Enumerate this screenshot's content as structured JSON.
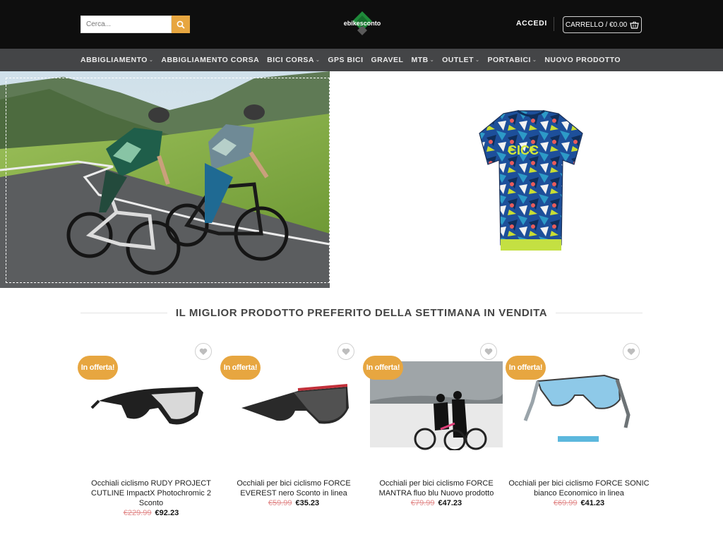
{
  "header": {
    "search_placeholder": "Cerca...",
    "logo_text": "ebikesconto",
    "login_label": "ACCEDI",
    "cart_label": "CARRELLO / €0.00"
  },
  "nav": {
    "items": [
      {
        "label": "ABBIGLIAMENTO",
        "dropdown": true
      },
      {
        "label": "ABBIGLIAMENTO CORSA",
        "dropdown": false
      },
      {
        "label": "BICI CORSA",
        "dropdown": true
      },
      {
        "label": "GPS BICI",
        "dropdown": false
      },
      {
        "label": "GRAVEL",
        "dropdown": false
      },
      {
        "label": "MTB",
        "dropdown": true
      },
      {
        "label": "OUTLET",
        "dropdown": true
      },
      {
        "label": "PORTABICI",
        "dropdown": true
      },
      {
        "label": "NUOVO PRODOTTO",
        "dropdown": false
      }
    ]
  },
  "section": {
    "title": "IL MIGLIOR PRODOTTO PREFERITO DELLA SETTIMANA IN VENDITA"
  },
  "products": [
    {
      "badge": "In offerta!",
      "title": "Occhiali ciclismo RUDY PROJECT CUTLINE ImpactX Photochromic 2 Sconto",
      "old_price": "€229.99",
      "new_price": "€92.23"
    },
    {
      "badge": "In offerta!",
      "title": "Occhiali per bici ciclismo FORCE EVEREST nero Sconto in linea",
      "old_price": "€59.99",
      "new_price": "€35.23"
    },
    {
      "badge": "In offerta!",
      "title": "Occhiali per bici ciclismo FORCE MANTRA fluo blu Nuovo prodotto",
      "old_price": "€79.99",
      "new_price": "€47.23"
    },
    {
      "badge": "In offerta!",
      "title": "Occhiali per bici ciclismo FORCE SONIC bianco Economico in linea",
      "old_price": "€69.99",
      "new_price": "€41.23"
    }
  ],
  "colors": {
    "accent": "#e7a640",
    "topbar": "#0e0e0e",
    "navbar": "#444547",
    "old_price": "#e28a8a"
  }
}
